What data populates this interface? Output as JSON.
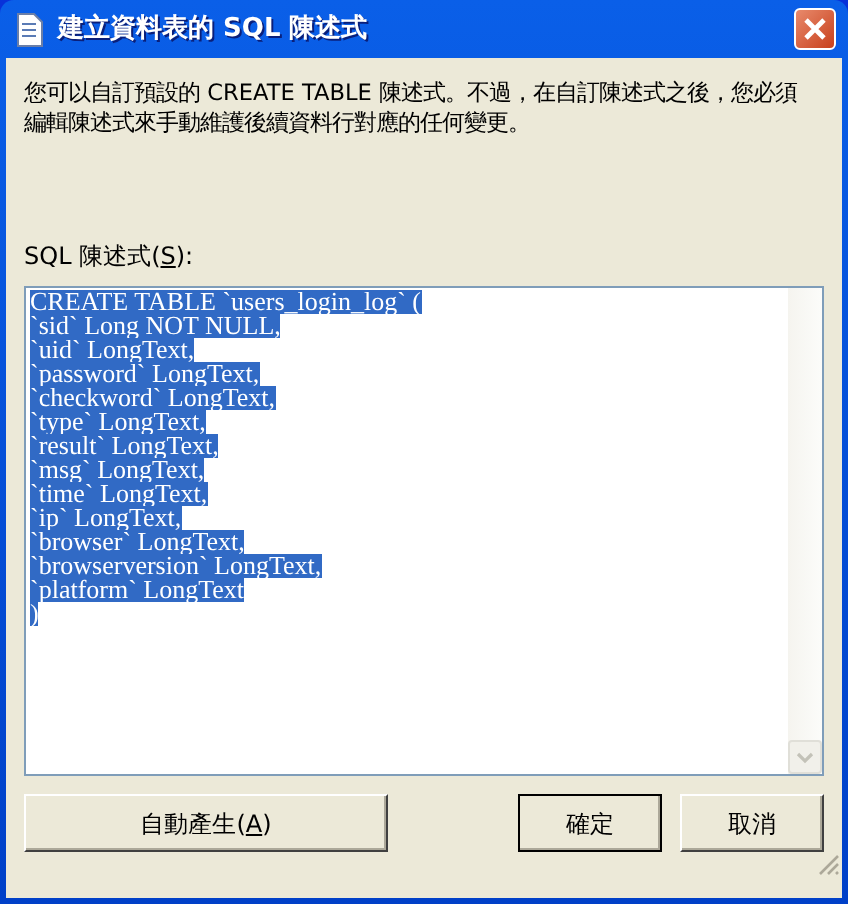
{
  "window": {
    "title": "建立資料表的 SQL 陳述式"
  },
  "description": "您可以自訂預設的 CREATE TABLE 陳述式。不過，在自訂陳述式之後，您必須編輯陳述式來手動維護後續資料行對應的任何變更。",
  "sql_label": {
    "before": "SQL 陳述式(",
    "access_key": "S",
    "after": "):"
  },
  "sql_field": {
    "text_selected": true,
    "lines": [
      "CREATE TABLE `users_login_log` (",
      "`sid` Long NOT NULL,",
      "`uid` LongText,",
      "`password` LongText,",
      "`checkword` LongText,",
      "`type` LongText,",
      "`result` LongText,",
      "`msg` LongText,",
      "`time` LongText,",
      "`ip` LongText,",
      "`browser` LongText,",
      "`browserversion` LongText,",
      "`platform` LongText",
      ")"
    ]
  },
  "buttons": [
    {
      "kind": "wide",
      "before": "自動產生(",
      "access_key": "A",
      "after": ")",
      "default": false
    },
    {
      "kind": "normal",
      "label": "確定",
      "default": true
    },
    {
      "kind": "normal",
      "label": "取消",
      "default": false
    }
  ]
}
